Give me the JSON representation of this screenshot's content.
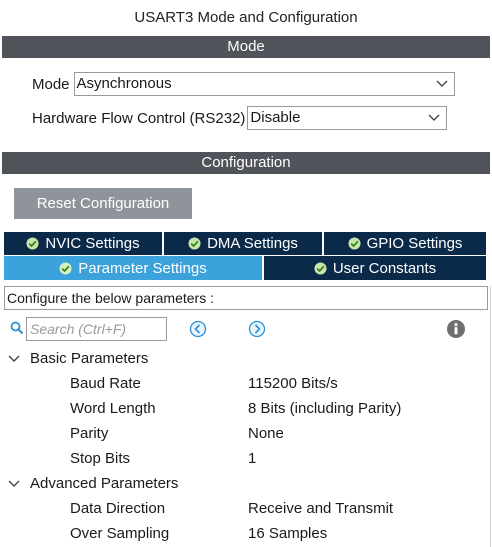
{
  "window": {
    "title": "USART3 Mode and Configuration"
  },
  "mode_section": {
    "header": "Mode",
    "mode": {
      "label": "Mode",
      "value": "Asynchronous"
    },
    "flow_control": {
      "label": "Hardware Flow Control (RS232)",
      "value": "Disable"
    }
  },
  "config_section": {
    "header": "Configuration",
    "reset_label": "Reset Configuration",
    "tabs_row1": [
      {
        "label": "NVIC Settings"
      },
      {
        "label": "DMA Settings"
      },
      {
        "label": "GPIO Settings"
      }
    ],
    "tabs_row2": [
      {
        "label": "Parameter Settings",
        "active": true
      },
      {
        "label": "User Constants",
        "active": false
      }
    ],
    "description": "Configure the below parameters :",
    "search": {
      "placeholder": "Search (Ctrl+F)"
    },
    "icons": {
      "search": "search-icon",
      "prev": "arrow-left-circle-icon",
      "next": "arrow-right-circle-icon",
      "info": "info-icon",
      "check": "check-circle-icon"
    },
    "colors": {
      "tab_dark": "#0b2a4a",
      "tab_active": "#3ca2dc",
      "section_bar": "#505359",
      "reset_button": "#8e9499",
      "icon_blue": "#2b8fd6"
    }
  },
  "parameters": {
    "basic": {
      "label": "Basic Parameters",
      "items": [
        {
          "name": "Baud Rate",
          "value": "115200 Bits/s"
        },
        {
          "name": "Word Length",
          "value": "8 Bits (including Parity)"
        },
        {
          "name": "Parity",
          "value": "None"
        },
        {
          "name": "Stop Bits",
          "value": "1"
        }
      ]
    },
    "advanced": {
      "label": "Advanced Parameters",
      "items": [
        {
          "name": "Data Direction",
          "value": "Receive and Transmit"
        },
        {
          "name": "Over Sampling",
          "value": "16 Samples"
        }
      ]
    }
  }
}
